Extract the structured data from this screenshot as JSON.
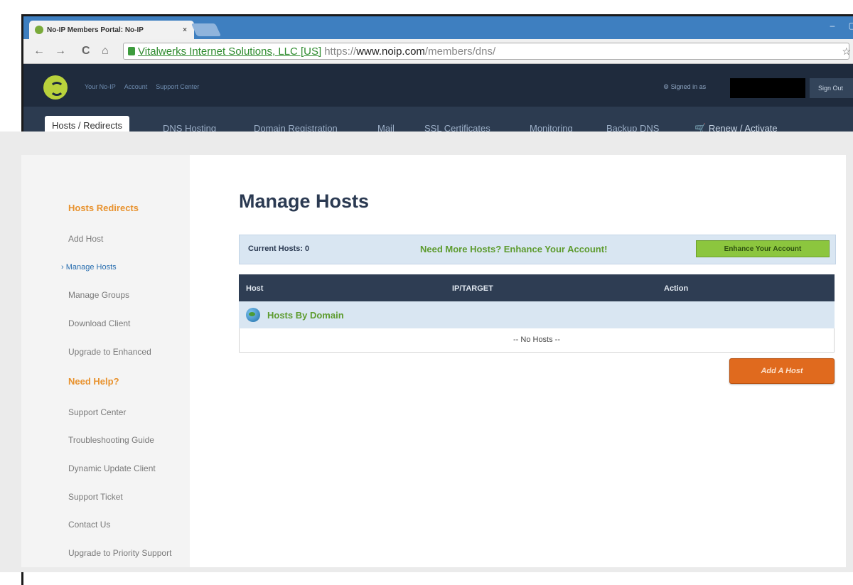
{
  "browser": {
    "tab_title": "No-IP Members Portal: No-IP",
    "tab_close": "×",
    "back": "←",
    "forward": "→",
    "reload": "C",
    "home": "⌂",
    "ev_cert": "Vitalwerks Internet Solutions, LLC [US]",
    "url_scheme": "https://",
    "url_host": "www.noip.com",
    "url_path": "/members/dns/",
    "addr_right": "☆ ⋮",
    "window_controls": "– ▢"
  },
  "topbar": {
    "links": [
      "Your No-IP",
      "Account",
      "Support Center"
    ],
    "signed_in": "Signed in as",
    "signout": "Sign Out"
  },
  "nav": {
    "items": [
      "Hosts / Redirects",
      "DNS Hosting",
      "Domain Registration",
      "Mail",
      "SSL Certificates",
      "Monitoring",
      "Backup DNS",
      "Renew / Activate"
    ],
    "cart_icon": "🛒"
  },
  "sidebar": {
    "section1": "Hosts Redirects",
    "items1": [
      "Add Host",
      "Manage Hosts",
      "Manage Groups",
      "Download Client",
      "Upgrade to Enhanced"
    ],
    "section2": "Need Help?",
    "items2": [
      "Support Center",
      "Troubleshooting Guide",
      "Dynamic Update Client",
      "Support Ticket",
      "Contact Us",
      "Upgrade to Priority Support"
    ],
    "current_bullet": "›"
  },
  "main": {
    "title": "Manage Hosts",
    "current_hosts": "Current Hosts: 0",
    "promo": "Need More Hosts? Enhance Your Account!",
    "enhance_button": "Enhance Your Account",
    "columns": [
      "Host",
      "IP/TARGET",
      "Action"
    ],
    "group_label": "Hosts By Domain",
    "empty": "-- No Hosts --",
    "add_button": "Add A Host"
  }
}
